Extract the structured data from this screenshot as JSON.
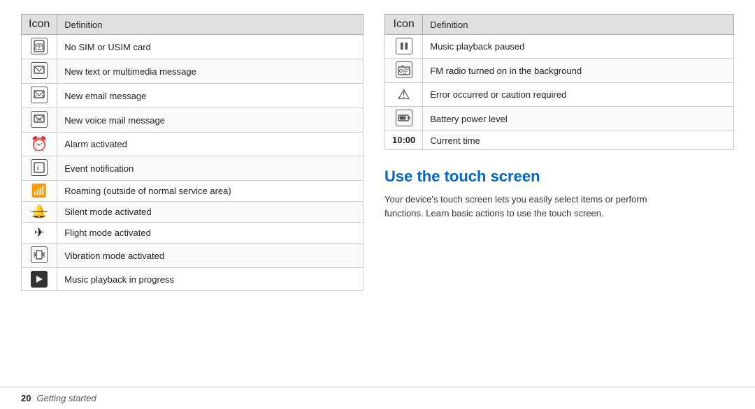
{
  "left_table": {
    "col1_header": "Icon",
    "col2_header": "Definition",
    "rows": [
      {
        "icon": "sim",
        "definition": "No SIM or USIM card"
      },
      {
        "icon": "msg",
        "definition": "New text or multimedia message"
      },
      {
        "icon": "email",
        "definition": "New email message"
      },
      {
        "icon": "voicemail",
        "definition": "New voice mail message"
      },
      {
        "icon": "alarm",
        "definition": "Alarm activated"
      },
      {
        "icon": "event",
        "definition": "Event notification"
      },
      {
        "icon": "roaming",
        "definition": "Roaming (outside of normal service area)"
      },
      {
        "icon": "silent",
        "definition": "Silent mode activated"
      },
      {
        "icon": "flight",
        "definition": "Flight mode activated"
      },
      {
        "icon": "vibration",
        "definition": "Vibration mode activated"
      },
      {
        "icon": "music",
        "definition": "Music playback in progress"
      }
    ]
  },
  "right_table": {
    "col1_header": "Icon",
    "col2_header": "Definition",
    "rows": [
      {
        "icon": "pause",
        "definition": "Music playback paused"
      },
      {
        "icon": "radio",
        "definition": "FM radio turned on in the background"
      },
      {
        "icon": "warning",
        "definition": "Error occurred or caution required"
      },
      {
        "icon": "battery",
        "definition": "Battery power level"
      },
      {
        "icon": "time",
        "definition": "Current time"
      }
    ]
  },
  "touch_section": {
    "title": "Use the touch screen",
    "description": "Your device's touch screen lets you easily select items or perform functions. Learn basic actions to use the touch screen."
  },
  "footer": {
    "page_number": "20",
    "page_label": "Getting started"
  }
}
